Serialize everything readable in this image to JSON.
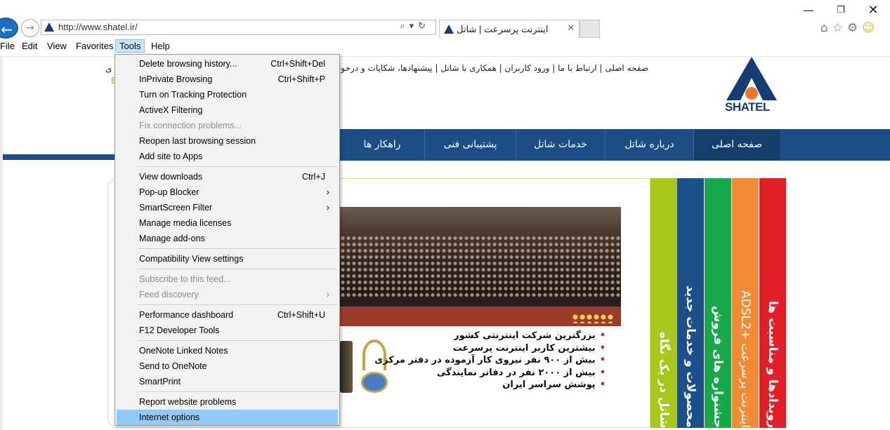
{
  "browser": {
    "url": "http://www.shatel.ir/",
    "tab_title": "اینترنت پرسرعت | شاتل",
    "tab_close": "✕",
    "back_icon": "←",
    "forward_icon": "→",
    "address_tools": "⌕▾↻",
    "window_min": "—",
    "window_max": "❐",
    "window_close": "✕",
    "toolbar_icons": {
      "home": "⌂",
      "favorites": "☆",
      "settings": "⚙",
      "smiley": "☺"
    }
  },
  "menubar": {
    "file": "File",
    "edit": "Edit",
    "view": "View",
    "favorites": "Favorites",
    "tools": "Tools",
    "help": "Help"
  },
  "tools_menu": {
    "items": [
      {
        "label": "Delete browsing history...",
        "shortcut": "Ctrl+Shift+Del",
        "disabled": false
      },
      {
        "label": "InPrivate Browsing",
        "shortcut": "Ctrl+Shift+P",
        "disabled": false
      },
      {
        "label": "Turn on Tracking Protection",
        "shortcut": "",
        "disabled": false
      },
      {
        "label": "ActiveX Filtering",
        "shortcut": "",
        "disabled": false
      },
      {
        "label": "Fix connection problems...",
        "shortcut": "",
        "disabled": true
      },
      {
        "label": "Reopen last browsing session",
        "shortcut": "",
        "disabled": false
      },
      {
        "label": "Add site to Apps",
        "shortcut": "",
        "disabled": false
      },
      {
        "label": "View downloads",
        "shortcut": "Ctrl+J",
        "disabled": false
      },
      {
        "label": "Pop-up Blocker",
        "shortcut": "",
        "submenu": true,
        "disabled": false
      },
      {
        "label": "SmartScreen Filter",
        "shortcut": "",
        "submenu": true,
        "disabled": false
      },
      {
        "label": "Manage media licenses",
        "shortcut": "",
        "disabled": false
      },
      {
        "label": "Manage add-ons",
        "shortcut": "",
        "disabled": false
      },
      {
        "label": "Compatibility View settings",
        "shortcut": "",
        "disabled": false
      },
      {
        "label": "Subscribe to this feed...",
        "shortcut": "",
        "disabled": true
      },
      {
        "label": "Feed discovery",
        "shortcut": "",
        "submenu": true,
        "disabled": true
      },
      {
        "label": "Performance dashboard",
        "shortcut": "Ctrl+Shift+U",
        "disabled": false
      },
      {
        "label": "F12 Developer Tools",
        "shortcut": "",
        "disabled": false
      },
      {
        "label": "OneNote Linked Notes",
        "shortcut": "",
        "disabled": false
      },
      {
        "label": "Send to OneNote",
        "shortcut": "",
        "disabled": false
      },
      {
        "label": "SmartPrint",
        "shortcut": "",
        "disabled": false
      },
      {
        "label": "Report website problems",
        "shortcut": "",
        "disabled": false
      },
      {
        "label": "Internet options",
        "shortcut": "",
        "disabled": false,
        "highlighted": true
      }
    ],
    "submenu_arrow": "›"
  },
  "site": {
    "top_links": "صفحه اصلی | ارتباط با ما | ورود کاربران | همکاری با شاتل | پیشنهادها، شکایات و درخواست",
    "top_left_fragment": "ی",
    "top_left_fragment2": "E",
    "logo_text": "SHATEL",
    "nav": [
      "صفحه اصلی",
      "درباره شاتل",
      "خدمات  شاتل",
      "پشتیبانی فنی",
      "راهکار ها"
    ],
    "bullets": [
      "بزرگترین شرکت اینترنتی کشور",
      "بیشترین کاربر اینترنت پرسرعت",
      "بیش از ۹۰۰ نفر نیروی کار آزموده در دفتر مرکزی",
      "بیش از ۲۰۰۰ نفر در دفاتر نمایندگی",
      "پوشش سراسر ایران"
    ],
    "side_tabs": [
      "شاتل در یک نگاه",
      "محصولات و خدمات جدید",
      "جشنواره های فروش",
      "اینترنت پرسرعت +ADSL2",
      "رویدادها و مناسبت ها"
    ],
    "colors": {
      "brand_blue": "#1c4d84",
      "brand_orange": "#f0772b",
      "tab_green_light": "#a7c71a",
      "tab_blue": "#1a4f8a",
      "tab_green": "#17a84a",
      "tab_orange": "#f08a35",
      "tab_red": "#e21e26"
    }
  }
}
